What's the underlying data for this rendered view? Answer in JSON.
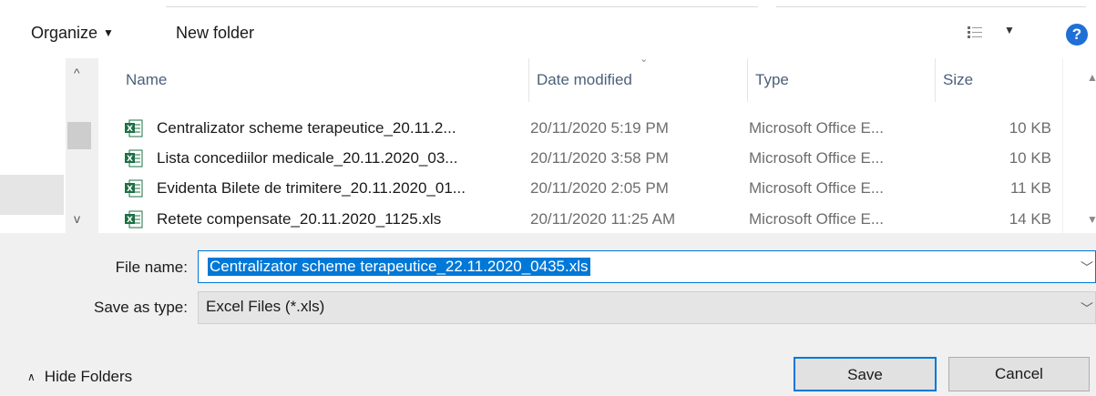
{
  "toolbar": {
    "organize_label": "Organize",
    "new_folder_label": "New folder",
    "view_icon": "details-view-icon",
    "help_label": "?"
  },
  "columns": {
    "name": "Name",
    "date_modified": "Date modified",
    "type": "Type",
    "size": "Size"
  },
  "files": [
    {
      "name": "Centralizator scheme terapeutice_20.11.2...",
      "date": "20/11/2020 5:19 PM",
      "type": "Microsoft Office E...",
      "size": "10 KB",
      "icon": "excel-file-icon"
    },
    {
      "name": "Lista concediilor medicale_20.11.2020_03...",
      "date": "20/11/2020 3:58 PM",
      "type": "Microsoft Office E...",
      "size": "10 KB",
      "icon": "excel-file-icon"
    },
    {
      "name": "Evidenta Bilete de trimitere_20.11.2020_01...",
      "date": "20/11/2020 2:05 PM",
      "type": "Microsoft Office E...",
      "size": "11 KB",
      "icon": "excel-file-icon"
    },
    {
      "name": "Retete compensate_20.11.2020_1125.xls",
      "date": "20/11/2020 11:25 AM",
      "type": "Microsoft Office E...",
      "size": "14 KB",
      "icon": "excel-file-icon"
    }
  ],
  "form": {
    "file_name_label": "File name:",
    "file_name_value": "Centralizator scheme terapeutice_22.11.2020_0435.xls",
    "save_as_type_label": "Save as type:",
    "save_as_type_value": "Excel Files (*.xls)"
  },
  "footer": {
    "hide_folders_label": "Hide Folders",
    "save_label": "Save",
    "cancel_label": "Cancel"
  },
  "colors": {
    "accent": "#0078d7",
    "excel_green": "#1d7044",
    "help_blue": "#1f6fd6"
  }
}
